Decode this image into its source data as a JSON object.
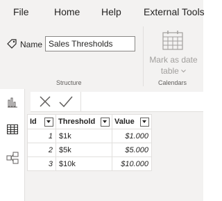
{
  "menu": {
    "items": [
      "File",
      "Home",
      "Help",
      "External Tools"
    ]
  },
  "ribbon": {
    "name_label": "Name",
    "name_value": "Sales Thresholds",
    "structure_label": "Structure",
    "mark_as_date_line1": "Mark as date",
    "mark_as_date_line2": "table",
    "calendars_label": "Calendars"
  },
  "leftnav": {
    "icons": [
      "report-view-icon",
      "data-view-icon",
      "model-view-icon"
    ],
    "active": "data-view-icon"
  },
  "formula_bar": {
    "cancel_icon": "cancel-x-icon",
    "commit_icon": "commit-check-icon"
  },
  "table": {
    "columns": [
      "Id",
      "Threshold",
      "Value"
    ],
    "rows": [
      [
        "1",
        "$1k",
        "$1.000"
      ],
      [
        "2",
        "$5k",
        "$5.000"
      ],
      [
        "3",
        "$10k",
        "$10.000"
      ]
    ]
  }
}
